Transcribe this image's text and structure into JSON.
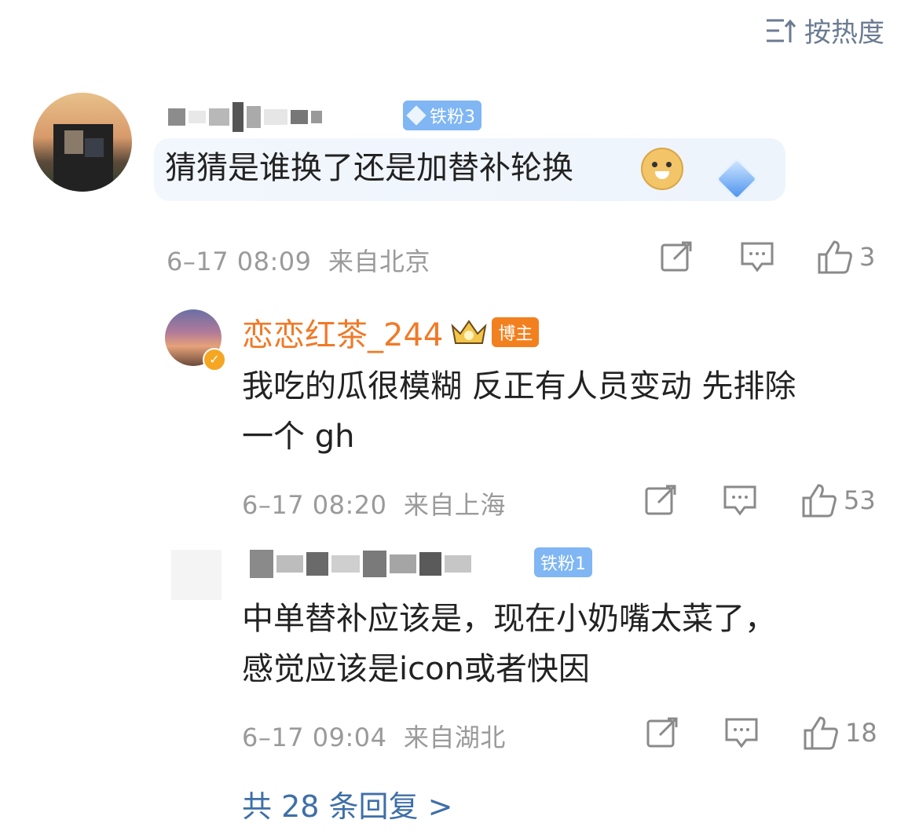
{
  "sort": {
    "label": "按热度",
    "icon": "sort-icon"
  },
  "comments": [
    {
      "badge": "铁粉3",
      "text": "猜猜是谁换了还是加替补轮换",
      "emoji": "doge-emoji",
      "time": "6–17 08:09",
      "location": "来自北京",
      "likes": "3"
    },
    {
      "name": "恋恋红茶_244",
      "tag": "博主",
      "text_line1": "我吃的瓜很模糊 反正有人员变动 先排除",
      "text_line2": "一个 gh",
      "time": "6–17 08:20",
      "location": "来自上海",
      "likes": "53"
    },
    {
      "badge": "铁粉1",
      "text_line1": "中单替补应该是，现在小奶嘴太菜了，",
      "text_line2": "感觉应该是icon或者快因",
      "time": "6–17 09:04",
      "location": "来自湖北",
      "likes": "18"
    }
  ],
  "more_replies": "共 28 条回复 >",
  "colors": {
    "accent": "#3f6fa8",
    "orange": "#f07a28",
    "fan_badge": "#7fb6f3"
  }
}
